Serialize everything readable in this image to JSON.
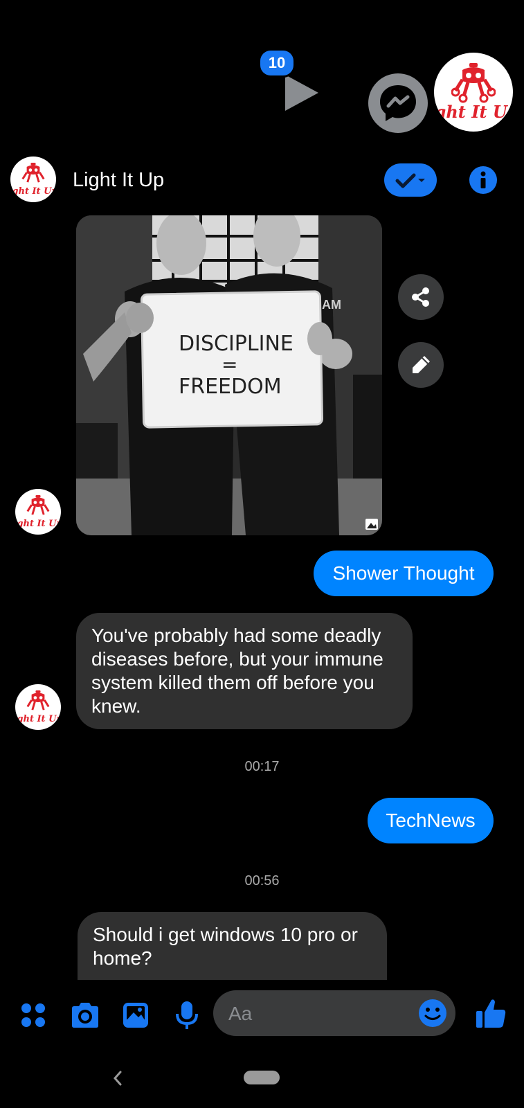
{
  "chat_heads": {
    "unread_badge": "10",
    "avatar_logo_text": "ight It Up"
  },
  "header": {
    "title": "Light It Up",
    "avatar_logo_text": "ight It Up"
  },
  "photo": {
    "sign_line1": "DISCIPLINE",
    "sign_line2": "=",
    "sign_line3": "FREEDOM",
    "shirt_text": "AM"
  },
  "messages": [
    {
      "type": "outgoing",
      "text": "Shower Thought"
    },
    {
      "type": "incoming",
      "text": "You've probably had some deadly diseases before, but your immune system killed them off before you knew."
    },
    {
      "type": "timestamp",
      "text": "00:17"
    },
    {
      "type": "outgoing",
      "text": "TechNews"
    },
    {
      "type": "timestamp",
      "text": "00:56"
    },
    {
      "type": "incoming",
      "text": "Should i get windows 10 pro or home?"
    }
  ],
  "composer": {
    "placeholder": "Aa"
  },
  "colors": {
    "accent": "#1877f2",
    "outgoing_bubble": "#0084ff",
    "incoming_bubble": "#303030",
    "logo_red": "#e0222c"
  }
}
